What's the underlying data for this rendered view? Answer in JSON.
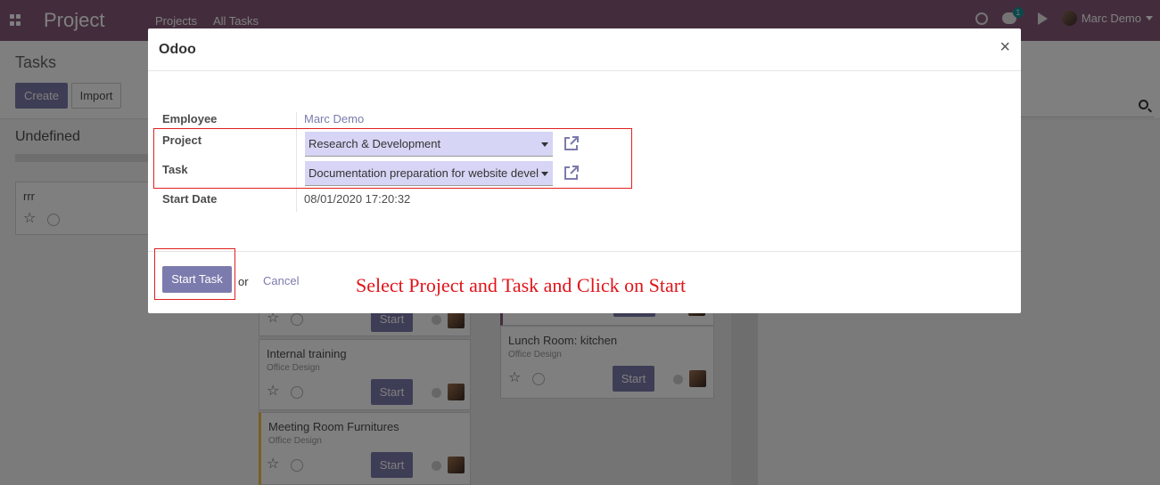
{
  "navbar": {
    "app_name": "Project",
    "menu": [
      "Projects",
      "All Tasks"
    ],
    "chat_count": "1",
    "user_name": "Marc Demo",
    "color": "#875a7b"
  },
  "control_panel": {
    "title": "Tasks",
    "create_label": "Create",
    "import_label": "Import"
  },
  "kanban": {
    "column_undefined_title": "Undefined",
    "cards": [
      {
        "title": "rrr",
        "subtitle": ""
      },
      {
        "title": "Internal training",
        "subtitle": "Office Design",
        "button": "Start"
      },
      {
        "title": "Meeting Room Furnitures",
        "subtitle": "Office Design",
        "button": "Start"
      },
      {
        "title": "Lunch Room: kitchen",
        "subtitle": "Office Design",
        "button": "Start"
      }
    ],
    "partial_start_label": "Start"
  },
  "dialog": {
    "title": "Odoo",
    "close_label": "×",
    "fields": {
      "employee": {
        "label": "Employee",
        "value": "Marc Demo"
      },
      "project": {
        "label": "Project",
        "value": "Research & Development"
      },
      "task": {
        "label": "Task",
        "value": "Documentation preparation for website devel"
      },
      "start_date": {
        "label": "Start Date",
        "value": "08/01/2020 17:20:32"
      }
    },
    "annotation": "Select Project and Task and Click on Start",
    "footer": {
      "start_task_label": "Start Task",
      "or_label": "or",
      "cancel_label": "Cancel"
    },
    "accent_color": "#7c7bad",
    "highlight_color": "#e02020"
  }
}
